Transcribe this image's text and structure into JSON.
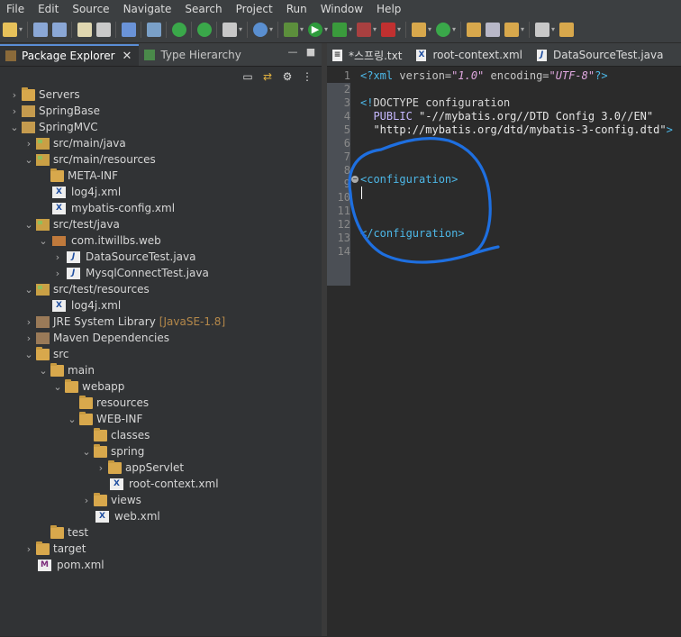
{
  "menu": [
    "File",
    "Edit",
    "Source",
    "Navigate",
    "Search",
    "Project",
    "Run",
    "Window",
    "Help"
  ],
  "left_view": {
    "tabs": [
      {
        "label": "Package Explorer",
        "active": true,
        "close": "✕"
      },
      {
        "label": "Type Hierarchy",
        "active": false
      }
    ]
  },
  "tree": [
    {
      "label": "Servers",
      "indent": 0,
      "twisty": "›",
      "icon": "folder"
    },
    {
      "label": "SpringBase",
      "indent": 0,
      "twisty": "›",
      "icon": "project"
    },
    {
      "label": "SpringMVC",
      "indent": 0,
      "twisty": "⌄",
      "icon": "project"
    },
    {
      "label": "src/main/java",
      "indent": 1,
      "twisty": "›",
      "icon": "pkgfolder"
    },
    {
      "label": "src/main/resources",
      "indent": 1,
      "twisty": "⌄",
      "icon": "pkgfolder"
    },
    {
      "label": "META-INF",
      "indent": 2,
      "twisty": "",
      "icon": "folder"
    },
    {
      "label": "log4j.xml",
      "indent": 2,
      "twisty": "",
      "icon": "xml"
    },
    {
      "label": "mybatis-config.xml",
      "indent": 2,
      "twisty": "",
      "icon": "xml"
    },
    {
      "label": "src/test/java",
      "indent": 1,
      "twisty": "⌄",
      "icon": "pkgfolder"
    },
    {
      "label": "com.itwillbs.web",
      "indent": 2,
      "twisty": "⌄",
      "icon": "package"
    },
    {
      "label": "DataSourceTest.java",
      "indent": 3,
      "twisty": "›",
      "icon": "java"
    },
    {
      "label": "MysqlConnectTest.java",
      "indent": 3,
      "twisty": "›",
      "icon": "java"
    },
    {
      "label": "src/test/resources",
      "indent": 1,
      "twisty": "⌄",
      "icon": "pkgfolder"
    },
    {
      "label": "log4j.xml",
      "indent": 2,
      "twisty": "",
      "icon": "xml"
    },
    {
      "label": "JRE System Library",
      "deco": "[JavaSE-1.8]",
      "indent": 1,
      "twisty": "›",
      "icon": "lib"
    },
    {
      "label": "Maven Dependencies",
      "indent": 1,
      "twisty": "›",
      "icon": "lib"
    },
    {
      "label": "src",
      "indent": 1,
      "twisty": "⌄",
      "icon": "folder"
    },
    {
      "label": "main",
      "indent": 2,
      "twisty": "⌄",
      "icon": "folder"
    },
    {
      "label": "webapp",
      "indent": 3,
      "twisty": "⌄",
      "icon": "folder"
    },
    {
      "label": "resources",
      "indent": 4,
      "twisty": "",
      "icon": "folder"
    },
    {
      "label": "WEB-INF",
      "indent": 4,
      "twisty": "⌄",
      "icon": "folder"
    },
    {
      "label": "classes",
      "indent": 5,
      "twisty": "",
      "icon": "folder"
    },
    {
      "label": "spring",
      "indent": 5,
      "twisty": "⌄",
      "icon": "folder"
    },
    {
      "label": "appServlet",
      "indent": 6,
      "twisty": "›",
      "icon": "folder"
    },
    {
      "label": "root-context.xml",
      "indent": 6,
      "twisty": "",
      "icon": "xml"
    },
    {
      "label": "views",
      "indent": 5,
      "twisty": "›",
      "icon": "folder"
    },
    {
      "label": "web.xml",
      "indent": 5,
      "twisty": "",
      "icon": "xml"
    },
    {
      "label": "test",
      "indent": 2,
      "twisty": "",
      "icon": "folder"
    },
    {
      "label": "target",
      "indent": 1,
      "twisty": "›",
      "icon": "folder"
    },
    {
      "label": "pom.xml",
      "indent": 1,
      "twisty": "",
      "icon": "pom"
    }
  ],
  "editor": {
    "tabs": [
      {
        "label": "*스프링.txt",
        "icon": "txt"
      },
      {
        "label": "root-context.xml",
        "icon": "xml"
      },
      {
        "label": "DataSourceTest.java",
        "icon": "java"
      }
    ],
    "line_numbers": [
      "1",
      "2",
      "3",
      "4",
      "5",
      "6",
      "7",
      "8",
      "9",
      "10",
      "11",
      "12",
      "13",
      "14"
    ],
    "code": {
      "l1_a": "<?xml ",
      "l1_b": "version=",
      "l1_c": "\"1.0\"",
      "l1_d": " encoding=",
      "l1_e": "\"UTF-8\"",
      "l1_f": "?>",
      "l3_a": "<!",
      "l3_b": "DOCTYPE configuration",
      "l4_a": "  PUBLIC ",
      "l4_b": "\"-//mybatis.org//DTD Config 3.0//EN\"",
      "l5_a": "  \"http://mybatis.org/dtd/mybatis-3-config.dtd\"",
      "l5_b": ">",
      "l7": "<configuration>",
      "l11": "</configuration>"
    },
    "annotation_color": "#1e6fe0"
  }
}
